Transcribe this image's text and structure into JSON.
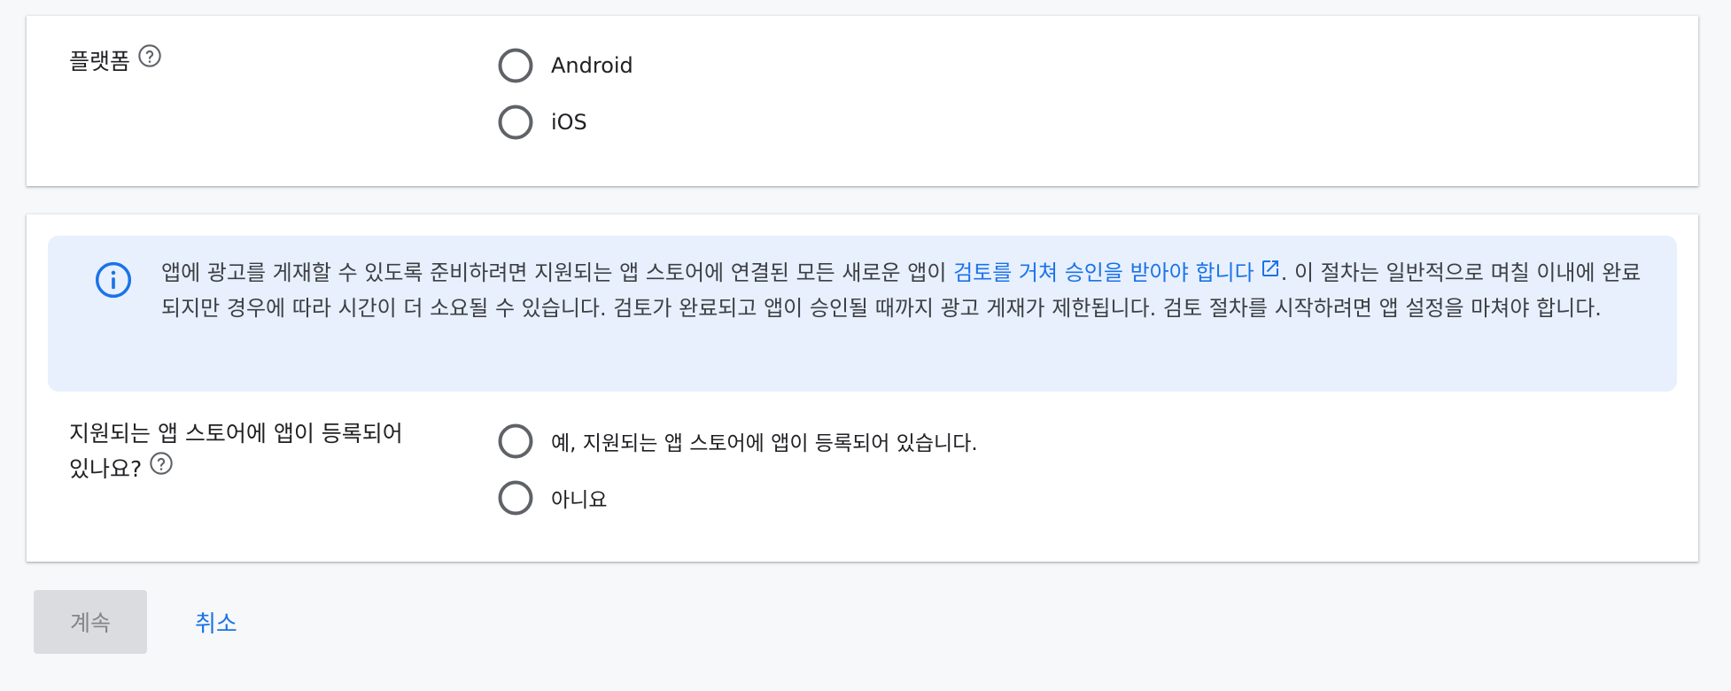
{
  "platform": {
    "label": "플랫폼",
    "options": [
      "Android",
      "iOS"
    ]
  },
  "notice": {
    "text_before": "앱에 광고를 게재할 수 있도록 준비하려면 지원되는 앱 스토어에 연결된 모든 새로운 앱이 ",
    "link_text": "검토를 거쳐 승인을 받아야 합니다",
    "text_after": ". 이 절차는 일반적으로 며칠 이내에 완료되지만 경우에 따라 시간이 더 소요될 수 있습니다. 검토가 완료되고 앱이 승인될 때까지 광고 게재가 제한됩니다. 검토 절차를 시작하려면 앱 설정을 마쳐야 합니다.",
    "icon": "info-icon"
  },
  "store": {
    "label_line1": "지원되는 앱 스토어에 앱이 등록되어",
    "label_line2": "있나요?",
    "options": [
      "예, 지원되는 앱 스토어에 앱이 등록되어 있습니다.",
      "아니요"
    ]
  },
  "actions": {
    "continue_label": "계속",
    "cancel_label": "취소"
  },
  "colors": {
    "accent": "#1a73e8",
    "info_background": "#e8f0fe",
    "disabled_button": "#dadce0",
    "radio_outline": "#5f6368"
  }
}
